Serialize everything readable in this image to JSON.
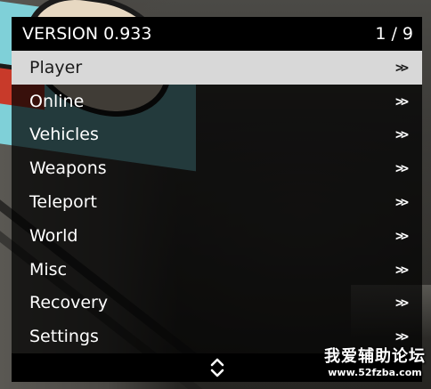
{
  "menu": {
    "version": "VERSION 0.933",
    "page_counter": "1 / 9",
    "selected_index": 0,
    "items": [
      {
        "label": "Player",
        "arrow": ">>"
      },
      {
        "label": "Online",
        "arrow": ">>"
      },
      {
        "label": "Vehicles",
        "arrow": ">>"
      },
      {
        "label": "Weapons",
        "arrow": ">>"
      },
      {
        "label": "Teleport",
        "arrow": ">>"
      },
      {
        "label": "World",
        "arrow": ">>"
      },
      {
        "label": "Misc",
        "arrow": ">>"
      },
      {
        "label": "Recovery",
        "arrow": ">>"
      },
      {
        "label": "Settings",
        "arrow": ">>"
      }
    ],
    "footer_icon": "scroll-up-down-icon"
  },
  "watermark": {
    "title": "我爱辅助论坛",
    "url": "www.52fzba.com"
  },
  "colors": {
    "header_bg": "#000000",
    "selected_bg": "#d8d8d8",
    "item_text": "#ffffff",
    "selected_text": "#1a1a1a"
  }
}
